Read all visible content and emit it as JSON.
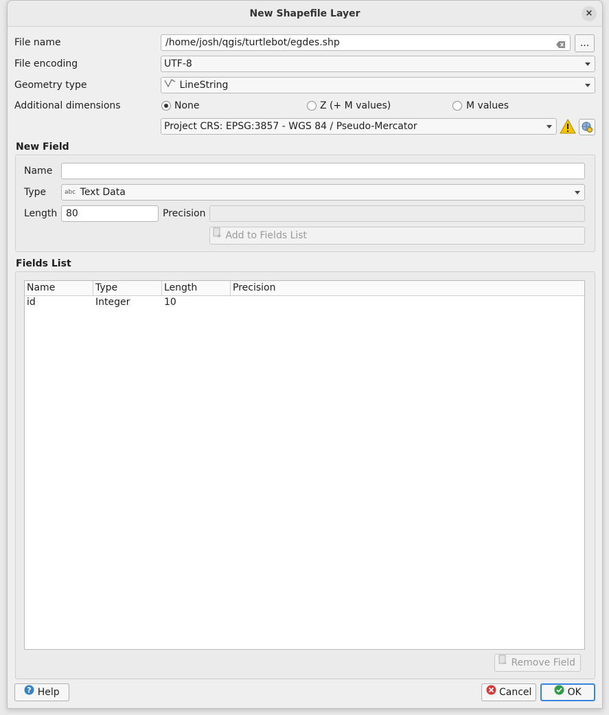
{
  "window": {
    "title": "New Shapefile Layer",
    "close_glyph": "×"
  },
  "file_name": {
    "label": "File name",
    "value": "/home/josh/qgis/turtlebot/egdes.shp",
    "browse_label": "..."
  },
  "file_encoding": {
    "label": "File encoding",
    "value": "UTF-8"
  },
  "geometry_type": {
    "label": "Geometry type",
    "value": "LineString",
    "icon": "linestring-icon"
  },
  "additional_dimensions": {
    "label": "Additional dimensions",
    "options": [
      {
        "label": "None",
        "checked": true
      },
      {
        "label": "Z (+ M values)",
        "checked": false
      },
      {
        "label": "M values",
        "checked": false
      }
    ]
  },
  "crs": {
    "value": "Project CRS: EPSG:3857 - WGS 84 / Pseudo-Mercator",
    "warning_color": "#f5c400"
  },
  "new_field": {
    "title": "New Field",
    "name_label": "Name",
    "name_value": "",
    "type_label": "Type",
    "type_value": "Text Data",
    "type_icon_text": "abc",
    "length_label": "Length",
    "length_value": "80",
    "precision_label": "Precision",
    "precision_value": "",
    "add_button": "Add to Fields List"
  },
  "fields_list": {
    "title": "Fields List",
    "columns": [
      "Name",
      "Type",
      "Length",
      "Precision"
    ],
    "rows": [
      {
        "name": "id",
        "type": "Integer",
        "length": "10",
        "precision": ""
      }
    ],
    "remove_button": "Remove Field"
  },
  "buttons": {
    "help": "Help",
    "cancel": "Cancel",
    "ok": "OK"
  },
  "colors": {
    "help_icon": "#3b82c4",
    "cancel_icon": "#d33a3a",
    "ok_icon": "#2e9d45",
    "ok_border": "#3584e4"
  }
}
